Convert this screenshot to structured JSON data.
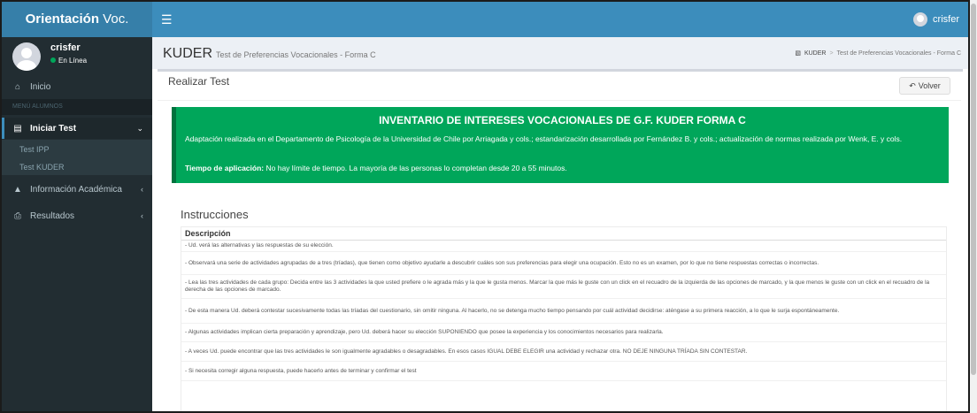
{
  "app": {
    "logo_bold": "Orientación",
    "logo_rest": "Voc."
  },
  "topbar": {
    "toggle_icon": "bars-icon",
    "user_name": "crisfer"
  },
  "sidebar": {
    "user": {
      "name": "crisfer",
      "status": "En Línea"
    },
    "items": [
      {
        "label": "Inicio",
        "icon": "home-icon"
      },
      {
        "label": "MENÚ ALUMNOS"
      },
      {
        "label": "Iniciar Test",
        "icon": "file-icon",
        "expanded": true
      },
      {
        "label": "Test IPP"
      },
      {
        "label": "Test KUDER"
      },
      {
        "label": "Información Académica",
        "icon": "graduation-cap-icon"
      },
      {
        "label": "Resultados",
        "icon": "print-icon"
      }
    ]
  },
  "content_header": {
    "title": "KUDER",
    "subtitle": "Test de Preferencias Vocacionales - Forma C",
    "breadcrumb": [
      "KUDER",
      "Test de Preferencias Vocacionales - Forma C"
    ]
  },
  "box": {
    "title": "Realizar Test",
    "back_button": "Volver"
  },
  "callout": {
    "heading": "INVENTARIO DE INTERESES VOCACIONALES DE G.F. KUDER FORMA C",
    "paragraph": "Adaptación realizada en el Departamento de Psicología de la Universidad de Chile por Arriagada y cols.; estandarización desarrollada por Fernández B. y cols.; actualización de normas realizada por Wenk, E. y cols.",
    "time_label": "Tiempo de aplicación:",
    "time_text": "No hay límite de tiempo. La mayoría de las personas lo completan desde 20 a 55 minutos."
  },
  "instructions": {
    "title": "Instrucciones",
    "column_header": "Descripción",
    "rows": [
      "- Ud. verá las alternativas y las respuestas de su elección.",
      "- Observará una serie de actividades agrupadas de a tres (tríadas), que tienen como objetivo ayudarle a descubrir cuáles son sus preferencias para elegir una ocupación. Esto no es un examen, por lo que no tiene respuestas correctas o incorrectas.",
      "- Lea las tres actividades de cada grupo: Decida entre las 3 actividades la que usted prefiere o le agrada más y la que le gusta menos. Marcar la que más le guste con un click en el recuadro de la izquierda de las opciones de marcado, y la que menos le guste con un click en el recuadro de la derecha de las opciones de marcado.",
      "- De esta manera Ud. deberá contestar sucesivamente todas las tríadas del cuestionario, sin omitir ninguna. Al hacerlo, no se detenga mucho tiempo pensando por cuál actividad decidirse: aténgase a su primera reacción, a lo que le surja espontáneamente.",
      "- Algunas actividades implican cierta preparación y aprendizaje, pero Ud. deberá hacer su elección SUPONIENDO que posee la experiencia y los conocimientos necesarios para realizarla.",
      "- A veces Ud. puede encontrar que las tres actividades le son igualmente agradables o desagradables. En esos casos IGUAL DEBE ELEGIR una actividad y rechazar otra. NO DEJE NINGUNA TRÍADA SIN CONTESTAR.",
      "- Si necesita corregir alguna respuesta, puede hacerlo antes de terminar y confirmar el test"
    ]
  }
}
